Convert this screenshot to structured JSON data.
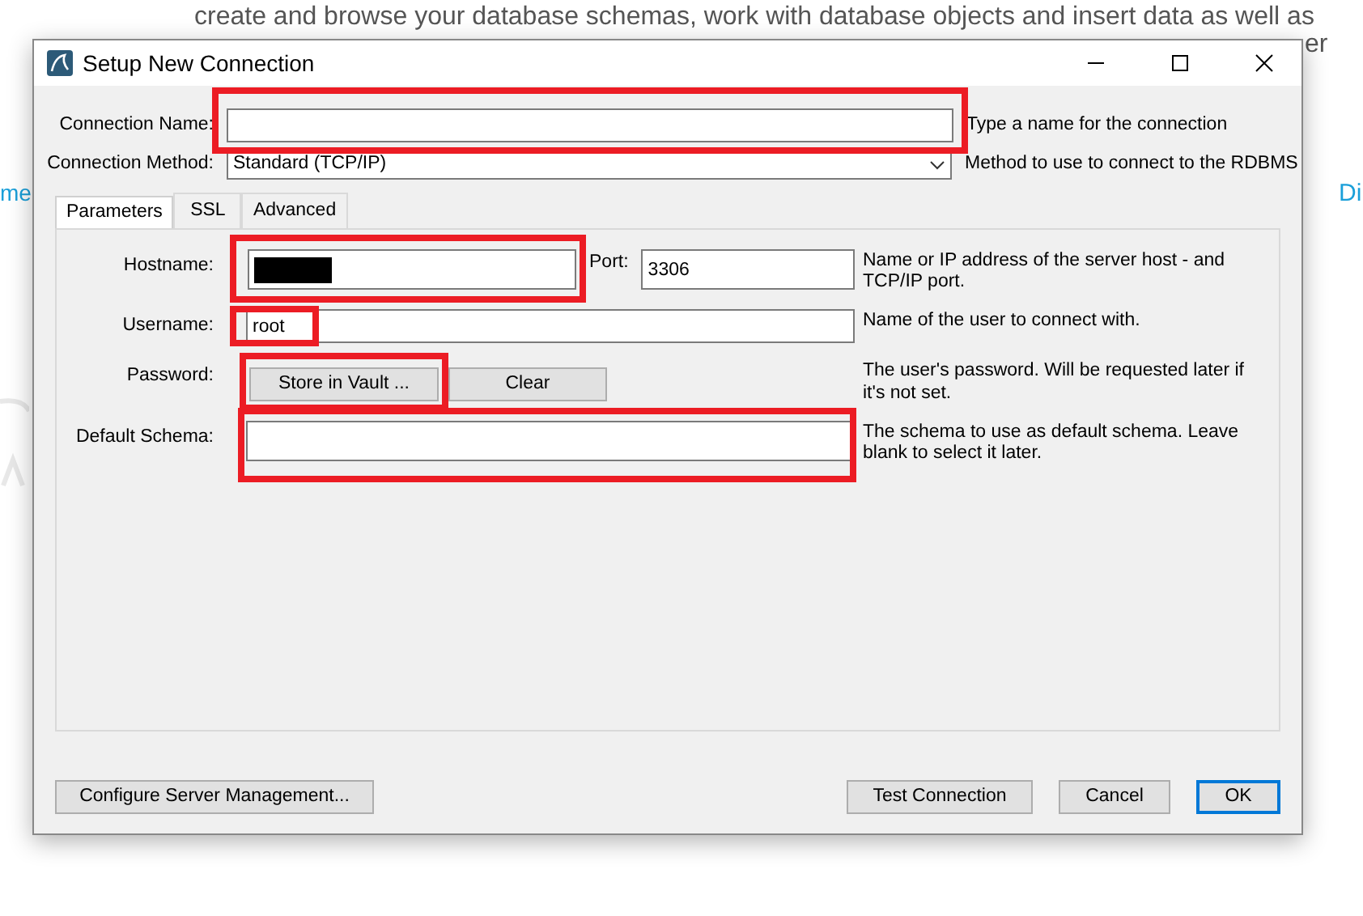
{
  "background_page": {
    "text_line": "create and browse your database schemas, work with database objects and insert data as well as",
    "right_fragment_top": "er",
    "left_fragment": "me",
    "right_fragment": "Di"
  },
  "dialog": {
    "title": "Setup New Connection",
    "connection_name": {
      "label": "Connection Name:",
      "hint": "Type a name for the connection",
      "highlighted": true
    },
    "connection_method": {
      "label": "Connection Method:",
      "value": "Standard (TCP/IP)",
      "hint": "Method to use to connect to the RDBMS"
    },
    "tabs": [
      {
        "label": "Parameters",
        "selected": true
      },
      {
        "label": "SSL",
        "selected": false
      },
      {
        "label": "Advanced",
        "selected": false
      }
    ],
    "parameters": [
      {
        "kind": "host_port",
        "label": "Hostname:",
        "redacted": true,
        "highlighted": true,
        "port_label": "Port:",
        "port_value": "3306",
        "hint": "Name or IP address of the server host - and TCP/IP port."
      },
      {
        "kind": "text",
        "label": "Username:",
        "value": "root",
        "highlighted": true,
        "hint": "Name of the user to connect with."
      },
      {
        "kind": "password",
        "label": "Password:",
        "store_button": "Store in Vault ...",
        "clear_button": "Clear",
        "highlighted": true,
        "hint": "The user's password. Will be requested later if it's not set."
      },
      {
        "kind": "text",
        "label": "Default Schema:",
        "highlighted": true,
        "hint": "The schema to use as default schema. Leave blank to select it later."
      }
    ],
    "footer_left": "Configure Server Management...",
    "footer_buttons": [
      {
        "label": "Test Connection",
        "default": false
      },
      {
        "label": "Cancel",
        "default": false
      },
      {
        "label": "OK",
        "default": true
      }
    ]
  }
}
